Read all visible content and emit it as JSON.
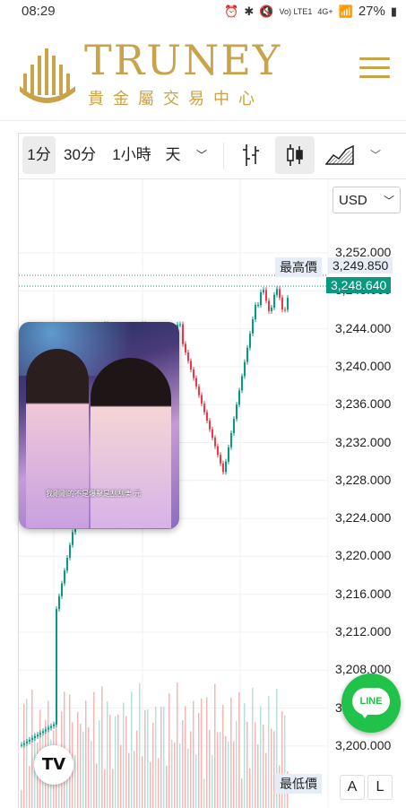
{
  "status_bar": {
    "time": "08:29",
    "network": "Vo) LTE1",
    "signal": "4G+",
    "battery": "27%"
  },
  "brand": {
    "name": "TRUNEY",
    "subtitle": "貴金屬交易中心",
    "accent_color": "#c9a349"
  },
  "toolbar": {
    "intervals": [
      "1分",
      "30分",
      "1小時",
      "天"
    ],
    "selected_interval": "1分",
    "dropdown_icon": "chevron-down-icon",
    "chart_type_icons": [
      "bar-chart-icon",
      "candlestick-icon",
      "area-chart-icon"
    ],
    "selected_chart_type": "candlestick-icon"
  },
  "currency": {
    "selected": "USD"
  },
  "price_axis": {
    "ticks": [
      "3,252.000",
      "3,248.000",
      "3,244.000",
      "3,240.000",
      "3,236.000",
      "3,232.000",
      "3,228.000",
      "3,224.000",
      "3,220.000",
      "3,216.000",
      "3,212.000",
      "3,208.000",
      "3,204.000",
      "3,200.000"
    ],
    "high_label": "最高價",
    "high_value": "3,249.850",
    "current_value": "3,248.640",
    "low_label": "最低價",
    "current_color": "#089981"
  },
  "video": {
    "caption": "我剛剛的不是爆擊是刮刮樂 元"
  },
  "buttons": {
    "a": "A",
    "l": "L",
    "line": "LINE"
  },
  "watermark": "TV"
}
